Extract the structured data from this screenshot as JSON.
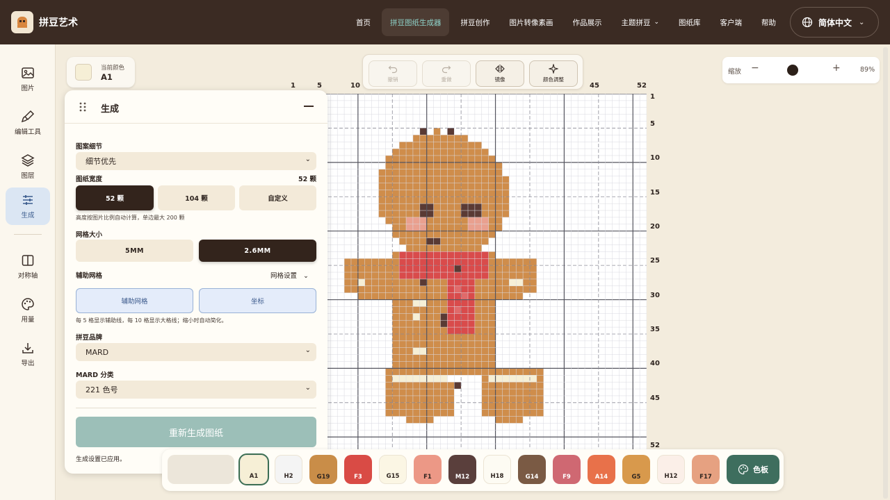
{
  "app": {
    "brand": "拼豆艺术",
    "lang": "简体中文",
    "nav": [
      {
        "label": "首页",
        "active": false,
        "dropdown": false
      },
      {
        "label": "拼豆图纸生成器",
        "active": true,
        "dropdown": false
      },
      {
        "label": "拼豆创作",
        "active": false,
        "dropdown": false
      },
      {
        "label": "图片转像素画",
        "active": false,
        "dropdown": false
      },
      {
        "label": "作品展示",
        "active": false,
        "dropdown": false
      },
      {
        "label": "主题拼豆",
        "active": false,
        "dropdown": true
      },
      {
        "label": "图纸库",
        "active": false,
        "dropdown": false
      },
      {
        "label": "客户端",
        "active": false,
        "dropdown": false
      },
      {
        "label": "帮助",
        "active": false,
        "dropdown": false
      }
    ]
  },
  "sidebar": {
    "items": [
      {
        "label": "图片",
        "icon": "image-icon",
        "active": false
      },
      {
        "label": "编辑工具",
        "icon": "brush-icon",
        "active": false
      },
      {
        "label": "图层",
        "icon": "layers-icon",
        "active": false
      },
      {
        "label": "生成",
        "icon": "sliders-icon",
        "active": true
      },
      {
        "label": "对称轴",
        "icon": "symmetry-icon",
        "active": false
      },
      {
        "label": "用量",
        "icon": "palette-icon",
        "active": false
      },
      {
        "label": "导出",
        "icon": "download-icon",
        "active": false
      }
    ]
  },
  "current_color": {
    "label": "当前颜色",
    "code": "A1",
    "hex": "#f6efd6"
  },
  "actions": {
    "undo": "撤销",
    "redo": "重做",
    "mirror": "镜像",
    "color_adjust": "颜色调整"
  },
  "zoom": {
    "label": "缩放",
    "minus": "−",
    "plus": "+",
    "value": "89%",
    "level": 0.45
  },
  "grid": {
    "cols": 52,
    "rows": 52,
    "col_labels": [
      "1",
      "5",
      "10",
      "45",
      "52"
    ],
    "row_labels": [
      "1",
      "5",
      "10",
      "15",
      "20",
      "25",
      "30",
      "35",
      "40",
      "45",
      "52"
    ],
    "colors": {
      "body": "#cf8d4b",
      "dark": "#5a3a34",
      "blush": "#e9a08f",
      "scarf": "#d94b4b",
      "scarf_light": "#e06a6a",
      "cream": "#f6efd6",
      "bg": "#ffffff",
      "line": "#d9d9e0"
    }
  },
  "panel": {
    "title": "生成",
    "detail_label": "图案细节",
    "detail_value": "细节优先",
    "width_label": "图纸宽度",
    "width_value": "52 颗",
    "width_options": [
      "52 颗",
      "104 颗",
      "自定义"
    ],
    "width_hint": "高度按图片比例自动计算，单边最大 200 颗",
    "grid_size_label": "网格大小",
    "grid_size_options": [
      "5MM",
      "2.6MM"
    ],
    "aux_label": "辅助网格",
    "aux_settings": "网格设置",
    "aux_options": [
      "辅助网格",
      "坐标"
    ],
    "aux_hint": "每 5 格显示辅助线，每 10 格显示大格线；缩小时自动简化。",
    "brand_label": "拼豆品牌",
    "brand_value": "MARD",
    "category_label": "MARD 分类",
    "category_value": "221 色号",
    "regen_button": "重新生成图纸",
    "applied_text": "生成设置已应用。"
  },
  "palette": {
    "chips": [
      {
        "code": "A1",
        "hex": "#f6efd6",
        "text": "#2f2520",
        "selected": true
      },
      {
        "code": "H2",
        "hex": "#f4f4f4",
        "text": "#2f2520",
        "selected": false
      },
      {
        "code": "G19",
        "hex": "#c98d48",
        "text": "#2f2520",
        "selected": false
      },
      {
        "code": "F3",
        "hex": "#d94b45",
        "text": "#ffffff",
        "selected": false
      },
      {
        "code": "G15",
        "hex": "#fbf6e4",
        "text": "#2f2520",
        "selected": false
      },
      {
        "code": "F1",
        "hex": "#ec9886",
        "text": "#2f2520",
        "selected": false
      },
      {
        "code": "M12",
        "hex": "#5a3f3c",
        "text": "#ffffff",
        "selected": false
      },
      {
        "code": "H18",
        "hex": "#fdfbf3",
        "text": "#2f2520",
        "selected": false
      },
      {
        "code": "G14",
        "hex": "#7a5a44",
        "text": "#ffffff",
        "selected": false
      },
      {
        "code": "F9",
        "hex": "#cf6872",
        "text": "#ffffff",
        "selected": false
      },
      {
        "code": "A14",
        "hex": "#e8714a",
        "text": "#ffffff",
        "selected": false
      },
      {
        "code": "G5",
        "hex": "#d8994c",
        "text": "#2f2520",
        "selected": false
      },
      {
        "code": "H12",
        "hex": "#fbefe8",
        "text": "#2f2520",
        "selected": false
      },
      {
        "code": "F17",
        "hex": "#e6a181",
        "text": "#2f2520",
        "selected": false
      }
    ],
    "palette_button": "色板"
  }
}
